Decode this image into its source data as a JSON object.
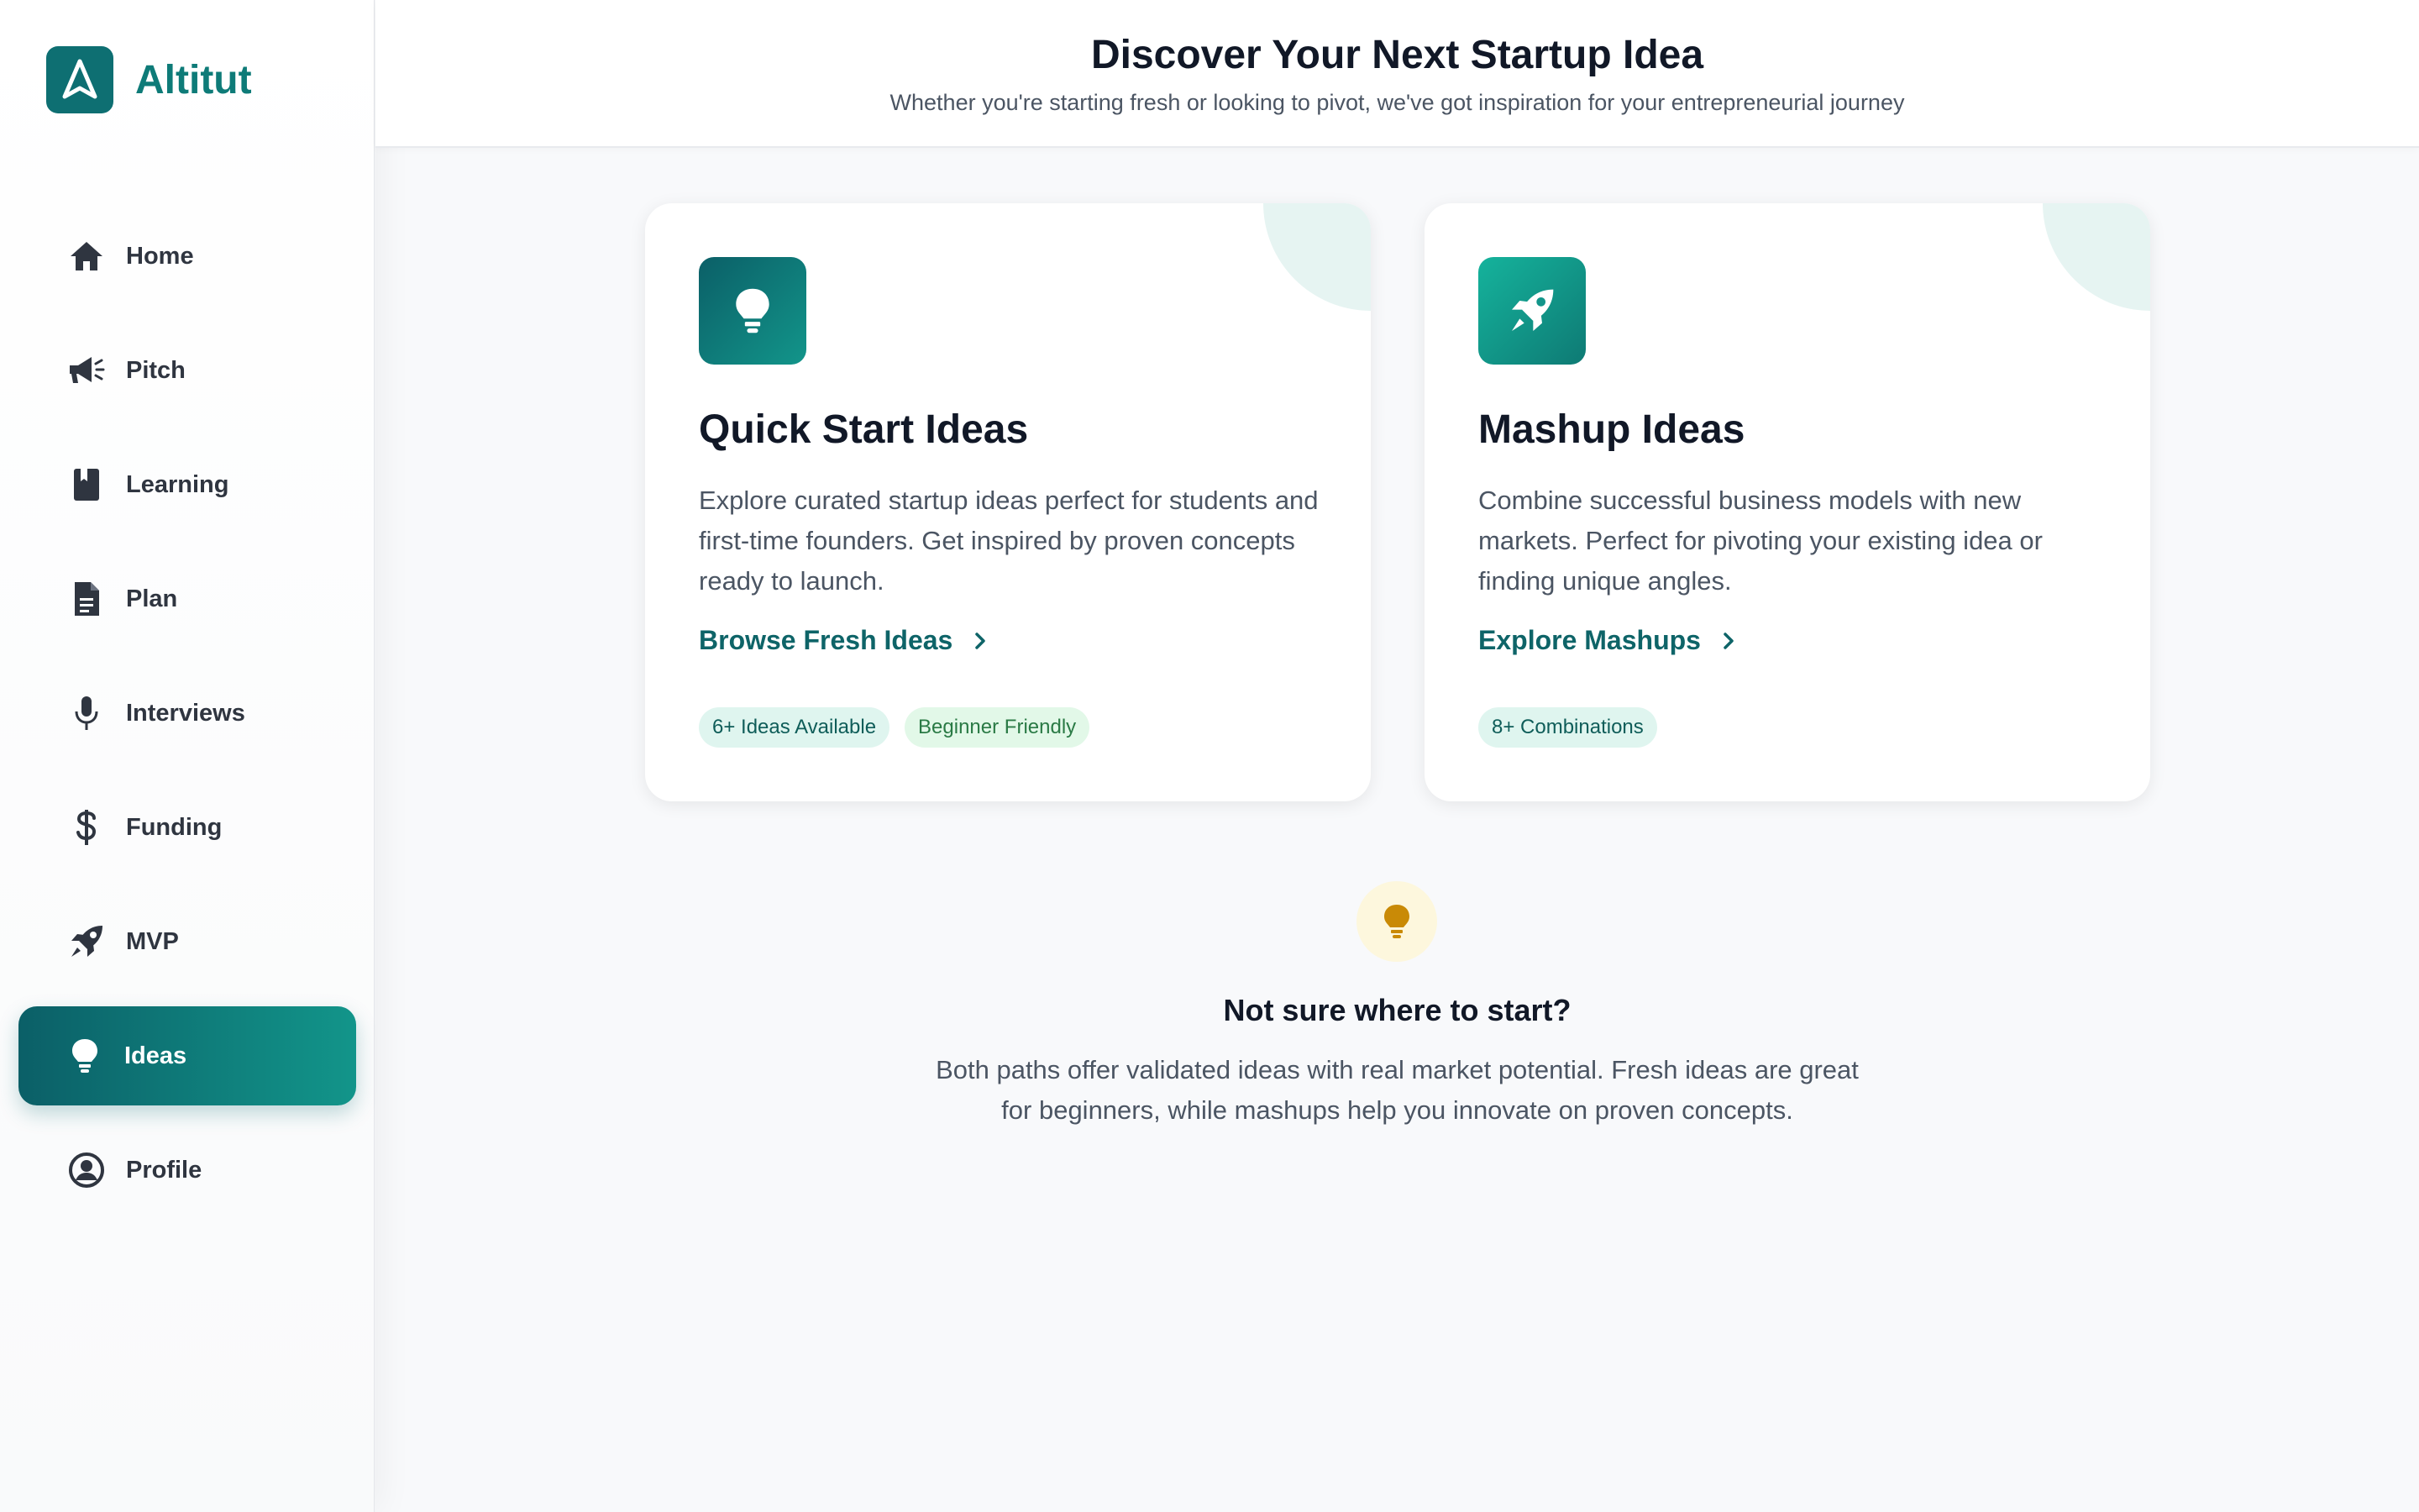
{
  "brand": {
    "name": "Altitut"
  },
  "sidebar": {
    "items": [
      {
        "label": "Home",
        "icon": "home-icon"
      },
      {
        "label": "Pitch",
        "icon": "megaphone-icon"
      },
      {
        "label": "Learning",
        "icon": "book-icon"
      },
      {
        "label": "Plan",
        "icon": "document-icon"
      },
      {
        "label": "Interviews",
        "icon": "microphone-icon"
      },
      {
        "label": "Funding",
        "icon": "dollar-icon"
      },
      {
        "label": "MVP",
        "icon": "rocket-icon"
      },
      {
        "label": "Ideas",
        "icon": "lightbulb-icon",
        "active": true
      },
      {
        "label": "Profile",
        "icon": "user-circle-icon"
      }
    ]
  },
  "header": {
    "title": "Discover Your Next Startup Idea",
    "subtitle": "Whether you're starting fresh or looking to pivot, we've got inspiration for your entrepreneurial journey"
  },
  "cards": [
    {
      "title": "Quick Start Ideas",
      "description": "Explore curated startup ideas perfect for students and first-time founders. Get inspired by proven concepts ready to launch.",
      "link_label": "Browse Fresh Ideas",
      "tags": [
        "6+ Ideas Available",
        "Beginner Friendly"
      ],
      "icon": "lightbulb-icon"
    },
    {
      "title": "Mashup Ideas",
      "description": "Combine successful business models with new markets. Perfect for pivoting your existing idea or finding unique angles.",
      "link_label": "Explore Mashups",
      "tags": [
        "8+ Combinations"
      ],
      "icon": "rocket-icon"
    }
  ],
  "hint": {
    "title": "Not sure where to start?",
    "text": "Both paths offer validated ideas with real market potential. Fresh ideas are great for beginners, while mashups help you innovate on proven concepts."
  },
  "colors": {
    "brand": "#0e6f72",
    "accent_gradient_start": "#0b5f67",
    "accent_gradient_end": "#12958a",
    "hint_icon": "#c98a06"
  }
}
